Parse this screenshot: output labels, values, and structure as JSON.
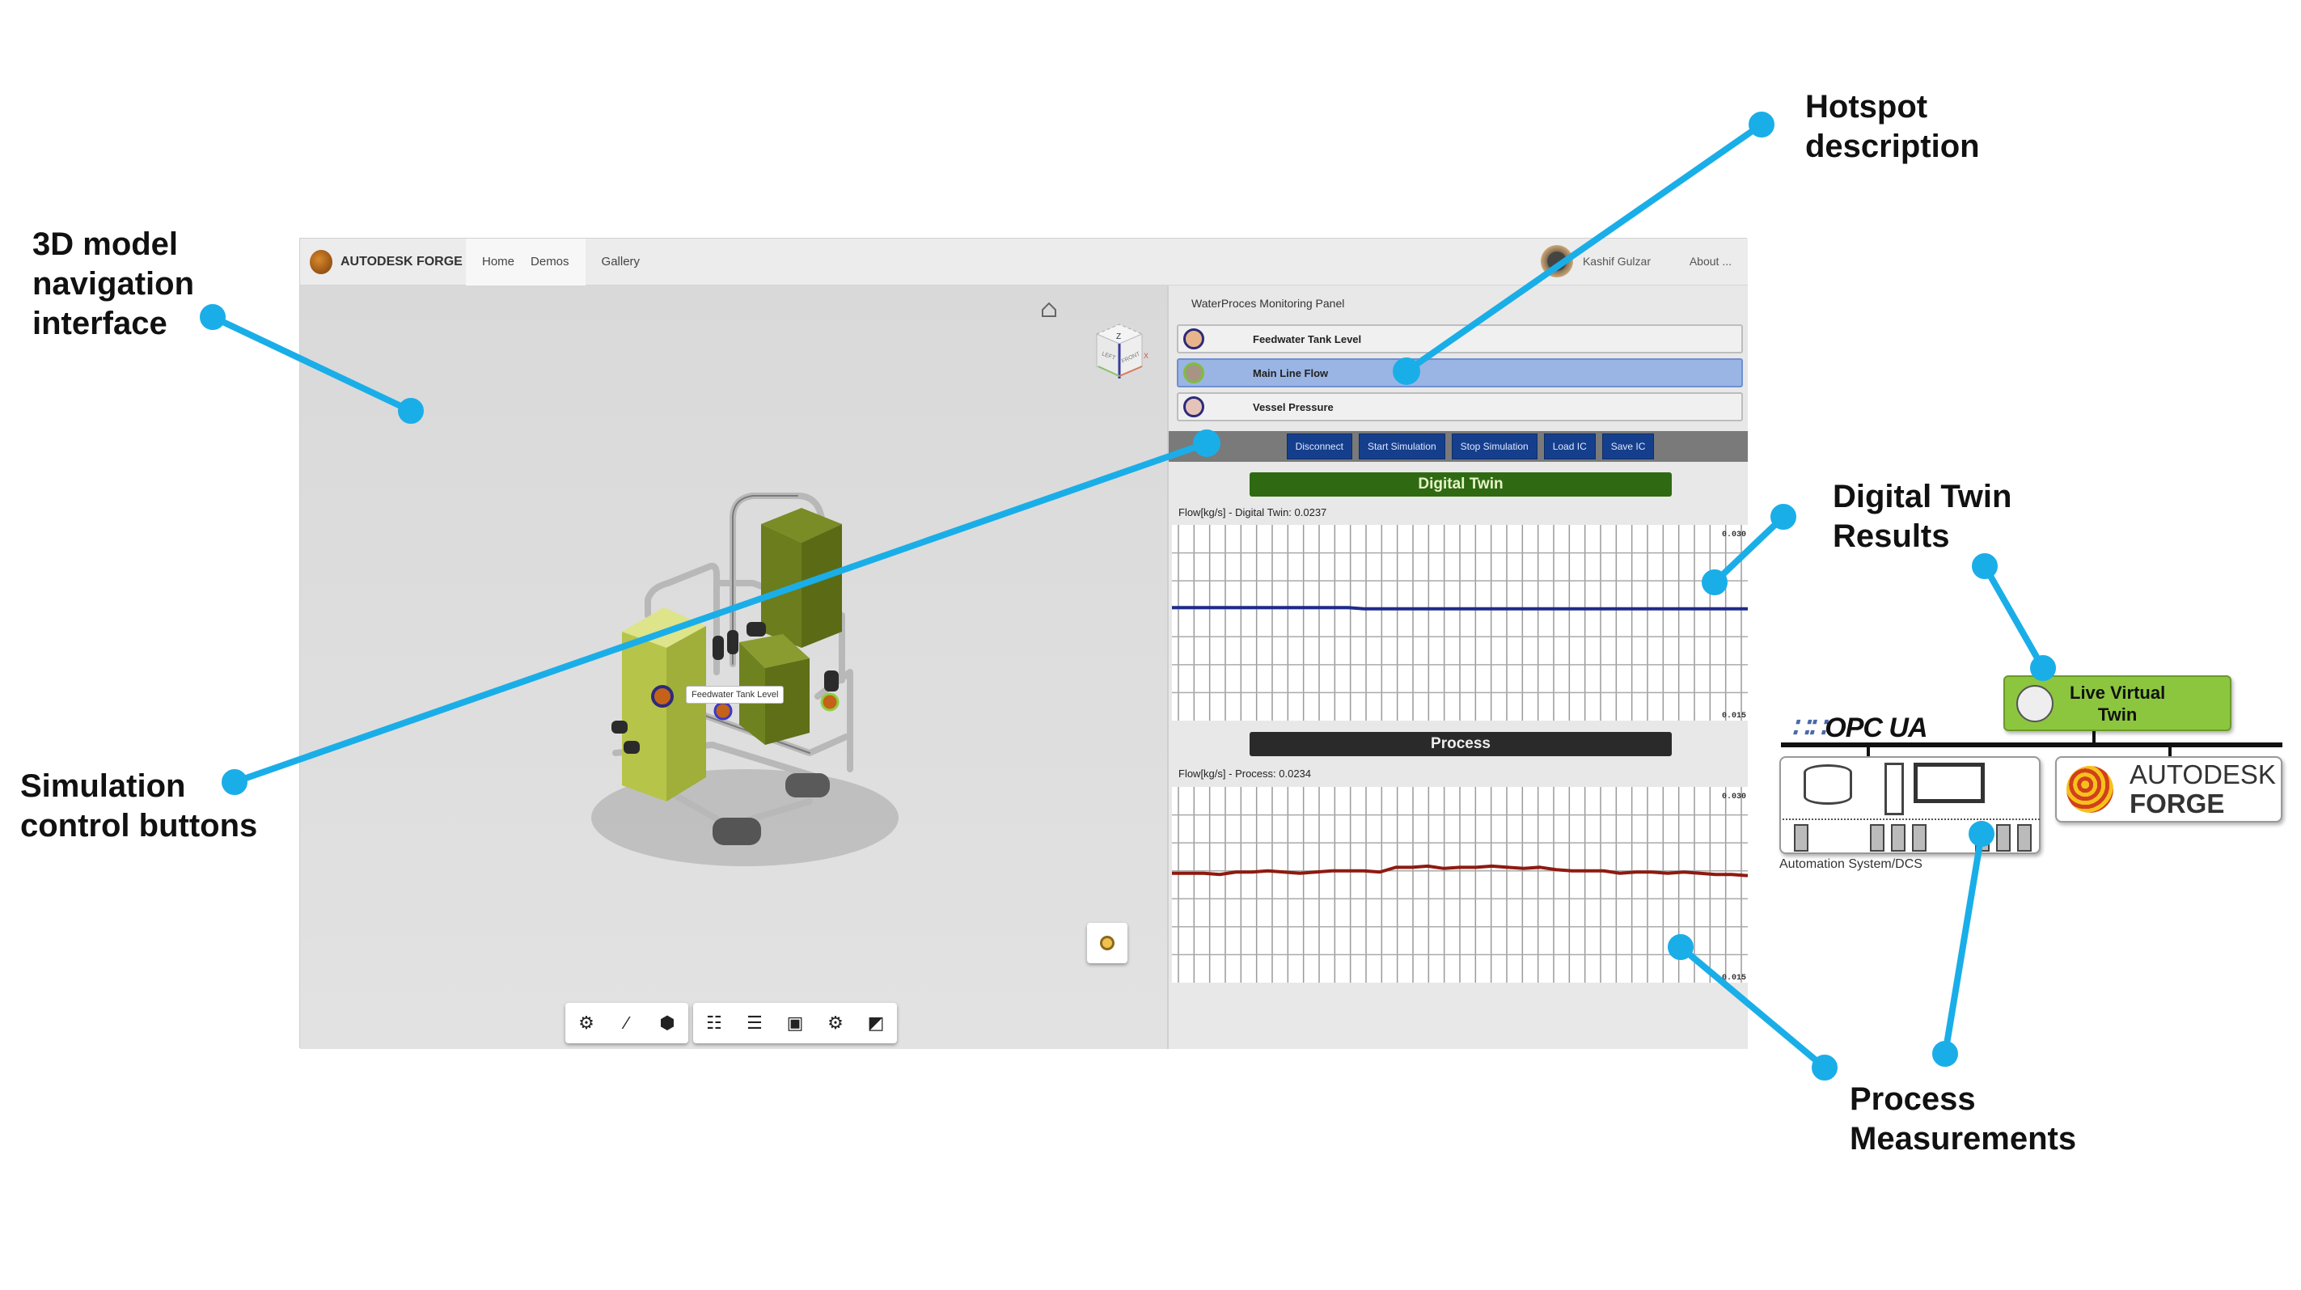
{
  "annotations": {
    "nav_interface": "3D model\nnavigation\ninterface",
    "hotspot": "Hotspot\ndescription",
    "dt_results": "Digital Twin\nResults",
    "sim_buttons": "Simulation\ncontrol buttons",
    "process": "Process\nMeasurements",
    "line_color": "#1aaee8"
  },
  "header": {
    "brand": "AUTODESK FORGE",
    "nav": [
      "Home",
      "Demos",
      "Gallery"
    ],
    "user": "Kashif Gulzar",
    "about": "About ..."
  },
  "viewer": {
    "tooltip": "Feedwater Tank Level",
    "viewcube": {
      "left": "LEFT",
      "front": "FRONT",
      "axis_x": "X",
      "axis_z": "Z"
    },
    "toolbar_icons": [
      "orbit-icon",
      "measure-icon",
      "explode-icon",
      "model-browser-icon",
      "layers-icon",
      "properties-icon",
      "settings-icon",
      "fullscreen-icon"
    ]
  },
  "panel": {
    "title": "WaterProces Monitoring Panel",
    "hotspots": [
      {
        "label": "Feedwater Tank Level",
        "color": "#e8b58a",
        "selected": false
      },
      {
        "label": "Main Line Flow",
        "color": "#a89484",
        "selected": true
      },
      {
        "label": "Vessel Pressure",
        "color": "#e6c3b8",
        "selected": false
      }
    ],
    "buttons": [
      "Disconnect",
      "Start Simulation",
      "Stop Simulation",
      "Load IC",
      "Save IC"
    ],
    "digital_twin_title": "Digital Twin",
    "process_title": "Process"
  },
  "chart_data": [
    {
      "type": "line",
      "title": "Flow[kg/s] - Digital Twin: 0.0237",
      "ylim": [
        0.015,
        0.03
      ],
      "ytick_labels": [
        "0.030",
        "0.015"
      ],
      "grid": true,
      "color": "#1f2a8c",
      "values": [
        0.0239,
        0.0239,
        0.0239,
        0.0239,
        0.0239,
        0.0239,
        0.0239,
        0.0239,
        0.0239,
        0.0239,
        0.0239,
        0.0239,
        0.0238,
        0.0238,
        0.0238,
        0.0238,
        0.0238,
        0.0238,
        0.0238,
        0.0238,
        0.0238,
        0.0238,
        0.0238,
        0.0238,
        0.0238,
        0.0238,
        0.0238,
        0.0238,
        0.0238,
        0.0238,
        0.0238,
        0.0238,
        0.0238,
        0.0238,
        0.0238,
        0.0238,
        0.0238
      ]
    },
    {
      "type": "line",
      "title": "Flow[kg/s] - Process: 0.0234",
      "ylim": [
        0.015,
        0.03
      ],
      "ytick_labels": [
        "0.030",
        "0.015"
      ],
      "grid": true,
      "color": "#8e1a10",
      "values": [
        0.0236,
        0.0236,
        0.0236,
        0.0235,
        0.0237,
        0.0237,
        0.0238,
        0.0237,
        0.0236,
        0.0237,
        0.0238,
        0.0238,
        0.0238,
        0.0237,
        0.0241,
        0.0241,
        0.0242,
        0.024,
        0.0241,
        0.0241,
        0.0242,
        0.0241,
        0.024,
        0.0241,
        0.0239,
        0.0238,
        0.0238,
        0.0238,
        0.0236,
        0.0237,
        0.0237,
        0.0236,
        0.0237,
        0.0236,
        0.0235,
        0.0235,
        0.0234
      ]
    }
  ],
  "diagram": {
    "live_twin": "Live Virtual\nTwin",
    "opc": "OPC UA",
    "forge_line1": "AUTODESK",
    "forge_line2": "FORGE",
    "automation": "Automation System/DCS"
  }
}
